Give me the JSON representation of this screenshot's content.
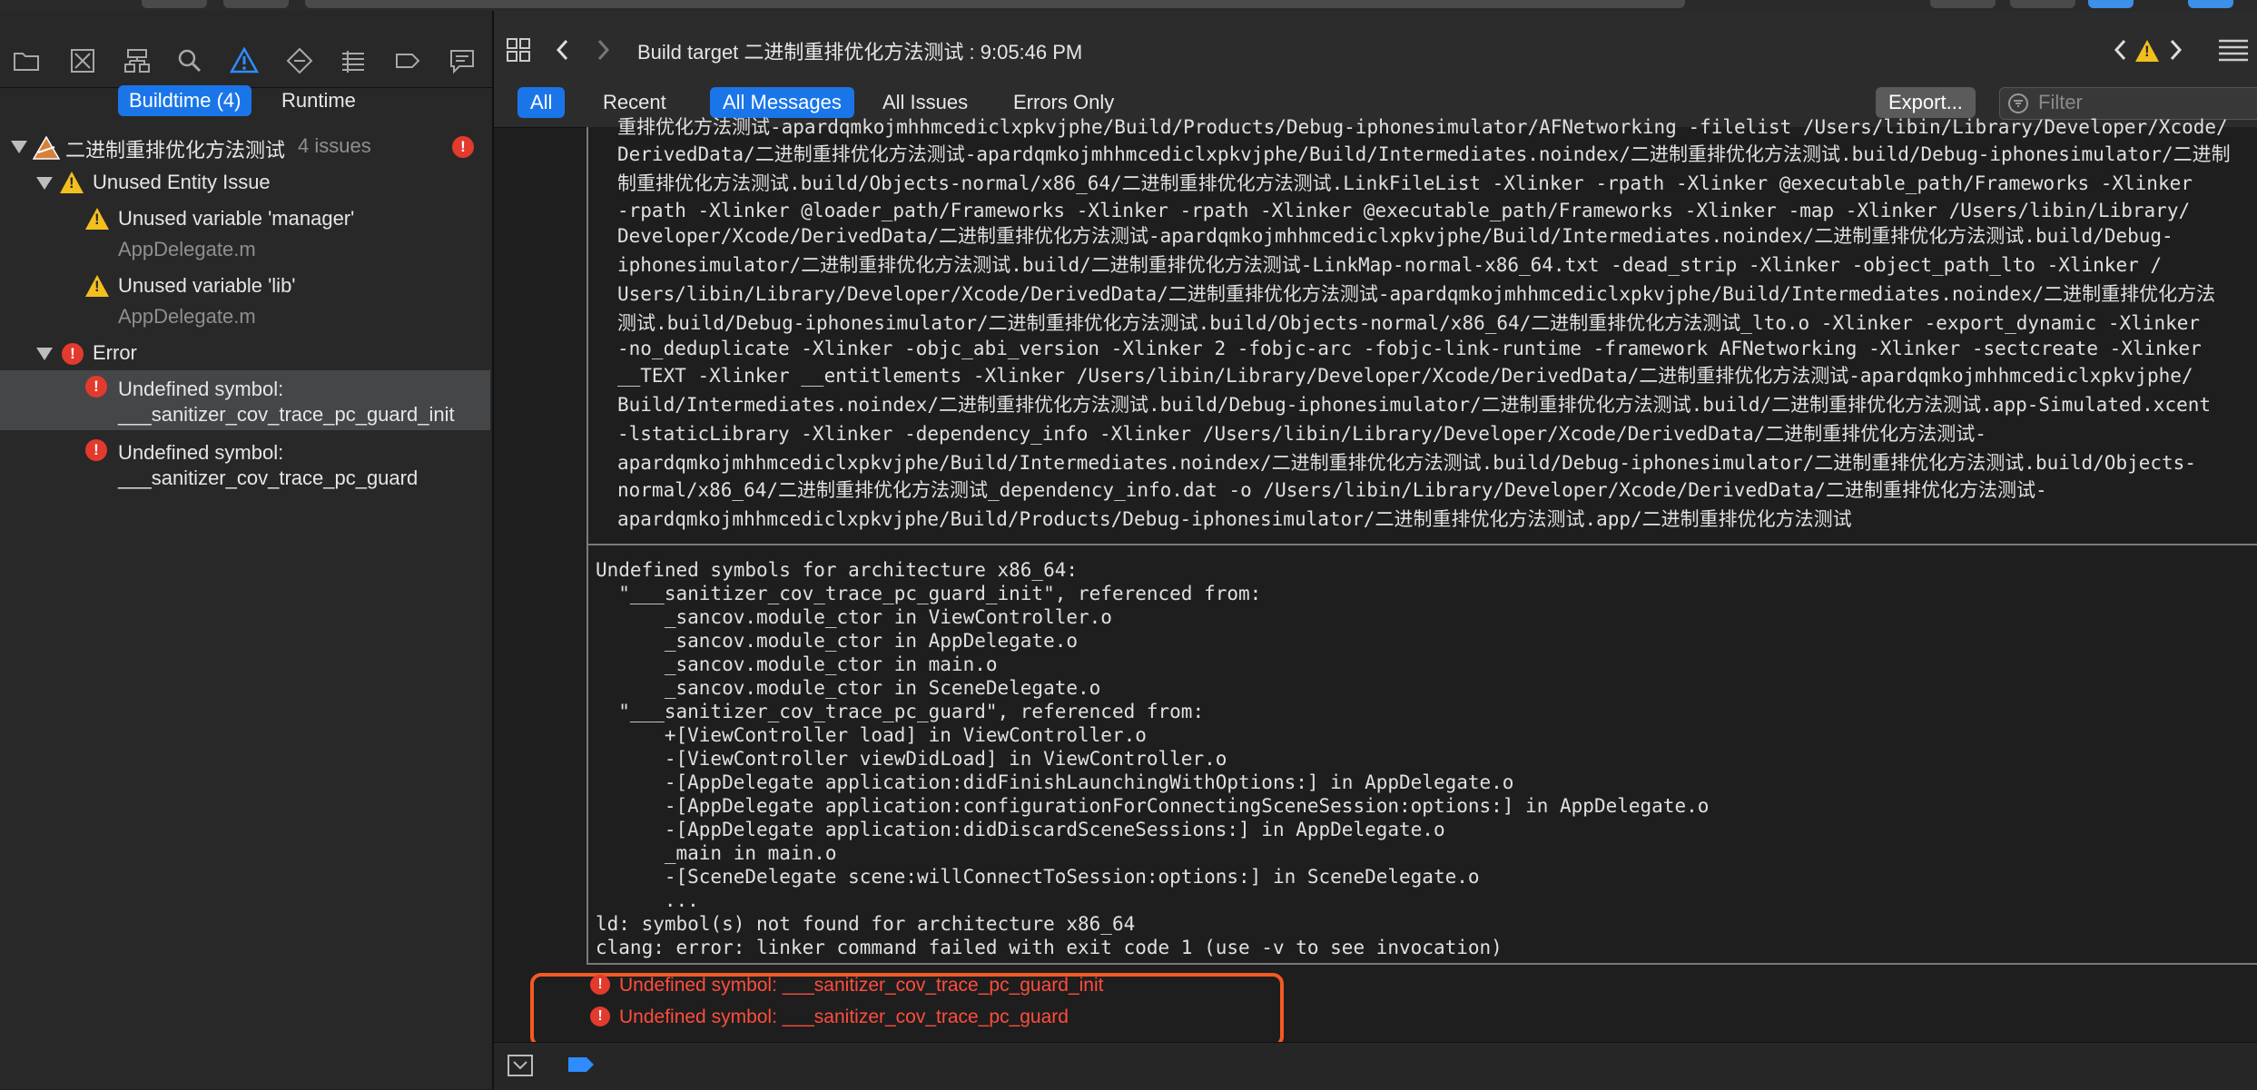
{
  "navigator": {
    "scope_tabs": [
      "Buildtime (4)",
      "Runtime"
    ],
    "project": {
      "name": "二进制重排优化方法测试",
      "issue_count": "4 issues"
    },
    "groups": [
      {
        "title": "Unused Entity Issue",
        "items": [
          {
            "title": "Unused variable 'manager'",
            "file": "AppDelegate.m"
          },
          {
            "title": "Unused variable 'lib'",
            "file": "AppDelegate.m"
          }
        ]
      },
      {
        "title": "Error",
        "items": [
          {
            "line1": "Undefined symbol:",
            "line2": "___sanitizer_cov_trace_pc_guard_init"
          },
          {
            "line1": "Undefined symbol:",
            "line2": "___sanitizer_cov_trace_pc_guard"
          }
        ]
      }
    ]
  },
  "editor": {
    "title": "Build target 二进制重排优化方法测试 : 9:05:46 PM",
    "filters": {
      "all": "All",
      "recent": "Recent",
      "all_messages": "All Messages",
      "all_issues": "All Issues",
      "errors_only": "Errors Only",
      "export": "Export...",
      "filter_placeholder": "Filter"
    },
    "command_lines": [
      "重排优化方法测试-apardqmkojmhhmcediclxpkvjphe/Build/Products/Debug-iphonesimulator/AFNetworking -filelist /Users/libin/Library/Developer/Xcode/",
      "DerivedData/二进制重排优化方法测试-apardqmkojmhhmcediclxpkvjphe/Build/Intermediates.noindex/二进制重排优化方法测试.build/Debug-iphonesimulator/二进制",
      "制重排优化方法测试.build/Objects-normal/x86_64/二进制重排优化方法测试.LinkFileList -Xlinker -rpath -Xlinker @executable_path/Frameworks -Xlinker",
      "-rpath -Xlinker @loader_path/Frameworks -Xlinker -rpath -Xlinker @executable_path/Frameworks -Xlinker -map -Xlinker /Users/libin/Library/",
      "Developer/Xcode/DerivedData/二进制重排优化方法测试-apardqmkojmhhmcediclxpkvjphe/Build/Intermediates.noindex/二进制重排优化方法测试.build/Debug-",
      "iphonesimulator/二进制重排优化方法测试.build/二进制重排优化方法测试-LinkMap-normal-x86_64.txt -dead_strip -Xlinker -object_path_lto -Xlinker /",
      "Users/libin/Library/Developer/Xcode/DerivedData/二进制重排优化方法测试-apardqmkojmhhmcediclxpkvjphe/Build/Intermediates.noindex/二进制重排优化方法",
      "测试.build/Debug-iphonesimulator/二进制重排优化方法测试.build/Objects-normal/x86_64/二进制重排优化方法测试_lto.o -Xlinker -export_dynamic -Xlinker",
      "-no_deduplicate -Xlinker -objc_abi_version -Xlinker 2 -fobjc-arc -fobjc-link-runtime -framework AFNetworking -Xlinker -sectcreate -Xlinker",
      "__TEXT -Xlinker __entitlements -Xlinker /Users/libin/Library/Developer/Xcode/DerivedData/二进制重排优化方法测试-apardqmkojmhhmcediclxpkvjphe/",
      "Build/Intermediates.noindex/二进制重排优化方法测试.build/Debug-iphonesimulator/二进制重排优化方法测试.build/二进制重排优化方法测试.app-Simulated.xcent",
      "-lstaticLibrary -Xlinker -dependency_info -Xlinker /Users/libin/Library/Developer/Xcode/DerivedData/二进制重排优化方法测试-",
      "apardqmkojmhhmcediclxpkvjphe/Build/Intermediates.noindex/二进制重排优化方法测试.build/Debug-iphonesimulator/二进制重排优化方法测试.build/Objects-",
      "normal/x86_64/二进制重排优化方法测试_dependency_info.dat -o /Users/libin/Library/Developer/Xcode/DerivedData/二进制重排优化方法测试-",
      "apardqmkojmhhmcediclxpkvjphe/Build/Products/Debug-iphonesimulator/二进制重排优化方法测试.app/二进制重排优化方法测试"
    ],
    "output_lines": [
      "Undefined symbols for architecture x86_64:",
      "  \"___sanitizer_cov_trace_pc_guard_init\", referenced from:",
      "      _sancov.module_ctor in ViewController.o",
      "      _sancov.module_ctor in AppDelegate.o",
      "      _sancov.module_ctor in main.o",
      "      _sancov.module_ctor in SceneDelegate.o",
      "  \"___sanitizer_cov_trace_pc_guard\", referenced from:",
      "      +[ViewController load] in ViewController.o",
      "      -[ViewController viewDidLoad] in ViewController.o",
      "      -[AppDelegate application:didFinishLaunchingWithOptions:] in AppDelegate.o",
      "      -[AppDelegate application:configurationForConnectingSceneSession:options:] in AppDelegate.o",
      "      -[AppDelegate application:didDiscardSceneSessions:] in AppDelegate.o",
      "      _main in main.o",
      "      -[SceneDelegate scene:willConnectToSession:options:] in SceneDelegate.o",
      "      ...",
      "ld: symbol(s) not found for architecture x86_64",
      "clang: error: linker command failed with exit code 1 (use -v to see invocation)"
    ],
    "error_messages": [
      "Undefined symbol: ___sanitizer_cov_trace_pc_guard_init",
      "Undefined symbol: ___sanitizer_cov_trace_pc_guard"
    ]
  },
  "colors": {
    "accent": "#1a76e8",
    "error": "#e33a2e",
    "warning": "#f3bf1f",
    "highlight_border": "#f25a22"
  }
}
